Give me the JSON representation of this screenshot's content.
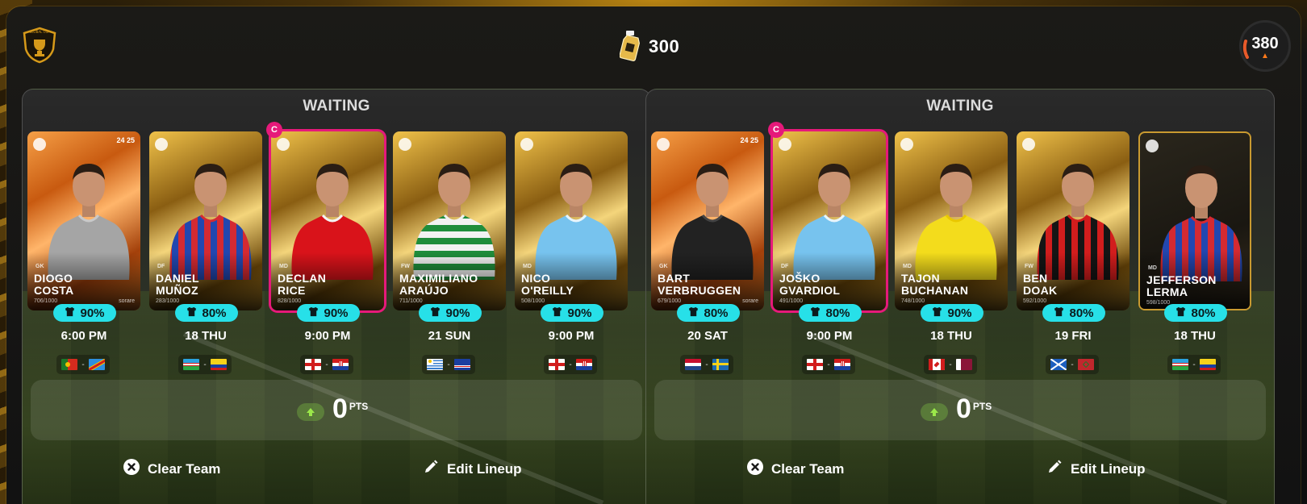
{
  "header": {
    "coin_value": "300",
    "score_value": "380",
    "logo_text": "GLOBAL CUP",
    "icons": {
      "logo": "shield-trophy-icon",
      "coin": "coin-bottle-icon",
      "score": "flame-icon"
    },
    "colors": {
      "accent_gold": "#d69a1a",
      "score_ring": "#e85a2a"
    }
  },
  "panels": [
    {
      "status": "WAITING",
      "points": "0",
      "points_unit": "PTS",
      "clear_label": "Clear Team",
      "edit_label": "Edit Lineup",
      "cards": [
        {
          "first": "DIOGO",
          "last": "COSTA",
          "season": "24 25",
          "pos": "GK",
          "serial": "706/1000",
          "brand": "sorare",
          "pct": "90%",
          "time": "6:00 PM",
          "captain": false,
          "style": "orange",
          "home": "portugal",
          "away": "dr-congo"
        },
        {
          "first": "DANIEL",
          "last": "MUÑOZ",
          "season": "",
          "pos": "DF",
          "serial": "283/1000",
          "brand": "",
          "pct": "80%",
          "time": "18 THU",
          "captain": false,
          "style": "gold",
          "home": "uzbekistan",
          "away": "colombia"
        },
        {
          "first": "DECLAN",
          "last": "RICE",
          "season": "",
          "pos": "MD",
          "serial": "828/1000",
          "brand": "",
          "pct": "90%",
          "time": "9:00 PM",
          "captain": true,
          "style": "gold",
          "home": "england",
          "away": "croatia"
        },
        {
          "first": "MAXIMILIANO",
          "last": "ARAÚJO",
          "season": "",
          "pos": "FW",
          "serial": "711/1000",
          "brand": "",
          "pct": "90%",
          "time": "21 SUN",
          "captain": false,
          "style": "gold",
          "home": "uruguay",
          "away": "cape-verde"
        },
        {
          "first": "NICO",
          "last": "O'REILLY",
          "season": "",
          "pos": "MD",
          "serial": "508/1000",
          "brand": "",
          "pct": "90%",
          "time": "9:00 PM",
          "captain": false,
          "style": "gold",
          "home": "england",
          "away": "croatia"
        }
      ]
    },
    {
      "status": "WAITING",
      "points": "0",
      "points_unit": "PTS",
      "clear_label": "Clear Team",
      "edit_label": "Edit Lineup",
      "cards": [
        {
          "first": "BART",
          "last": "VERBRUGGEN",
          "season": "24 25",
          "pos": "GK",
          "serial": "679/1000",
          "brand": "sorare",
          "pct": "80%",
          "time": "20 SAT",
          "captain": false,
          "style": "orange",
          "home": "netherlands",
          "away": "sweden"
        },
        {
          "first": "JOŠKO",
          "last": "GVARDIOL",
          "season": "",
          "pos": "DF",
          "serial": "491/1000",
          "brand": "",
          "pct": "80%",
          "time": "9:00 PM",
          "captain": true,
          "style": "gold",
          "home": "england",
          "away": "croatia"
        },
        {
          "first": "TAJON",
          "last": "BUCHANAN",
          "season": "",
          "pos": "MD",
          "serial": "748/1000",
          "brand": "",
          "pct": "90%",
          "time": "18 THU",
          "captain": false,
          "style": "gold",
          "home": "canada",
          "away": "qatar"
        },
        {
          "first": "BEN",
          "last": "DOAK",
          "season": "",
          "pos": "FW",
          "serial": "592/1000",
          "brand": "",
          "pct": "80%",
          "time": "19 FRI",
          "captain": false,
          "style": "gold",
          "home": "scotland",
          "away": "morocco"
        },
        {
          "first": "JEFFERSON",
          "last": "LERMA",
          "season": "",
          "pos": "MD",
          "serial": "598/1000",
          "brand": "",
          "pct": "80%",
          "time": "18 THU",
          "captain": false,
          "style": "dark",
          "home": "uzbekistan",
          "away": "colombia"
        }
      ]
    }
  ]
}
